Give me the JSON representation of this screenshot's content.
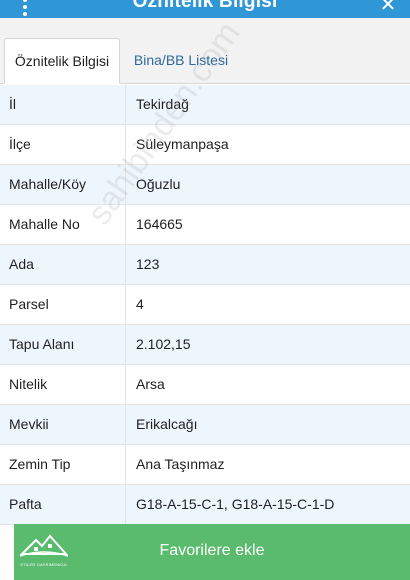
{
  "header": {
    "title": "Öznitelik Bilgisi",
    "close_symbol": "✕"
  },
  "tabs": [
    {
      "label": "Öznitelik Bilgisi",
      "active": true
    },
    {
      "label": "Bina/BB Listesi",
      "active": false
    }
  ],
  "rows": [
    {
      "label": "İl",
      "value": "Tekirdağ"
    },
    {
      "label": "İlçe",
      "value": "Süleymanpaşa"
    },
    {
      "label": "Mahalle/Köy",
      "value": "Oğuzlu"
    },
    {
      "label": "Mahalle No",
      "value": "164665"
    },
    {
      "label": "Ada",
      "value": "123"
    },
    {
      "label": "Parsel",
      "value": "4"
    },
    {
      "label": "Tapu Alanı",
      "value": "2.102,15"
    },
    {
      "label": "Nitelik",
      "value": "Arsa"
    },
    {
      "label": "Mevkii",
      "value": "Erikalcağı"
    },
    {
      "label": "Zemin Tip",
      "value": "Ana Taşınmaz"
    },
    {
      "label": "Pafta",
      "value": "G18-A-15-C-1, G18-A-15-C-1-D"
    }
  ],
  "footer": {
    "button_label": "Favorilere ekle",
    "logo_text": "STILER GAYRIMENKUL"
  },
  "watermark": "sahibinden.com",
  "colors": {
    "header": "#2f97d6",
    "button": "#5aba6e",
    "row_alt": "#eef6fd"
  }
}
